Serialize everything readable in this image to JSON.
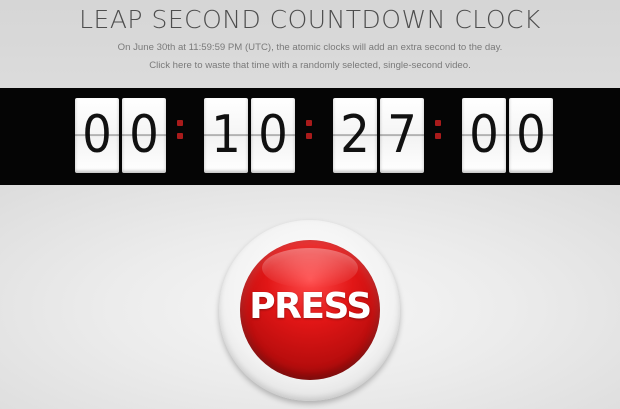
{
  "header": {
    "title": "LEAP SECOND COUNTDOWN CLOCK",
    "line1": "On June 30th at 11:59:59 PM (UTC), the atomic clocks will add an extra second to the day.",
    "line2": "Click here to waste that time with a randomly selected, single-second video."
  },
  "countdown": {
    "digits": [
      "0",
      "0",
      "1",
      "0",
      "2",
      "7",
      "0",
      "0"
    ],
    "separator_color": "#a91b1b"
  },
  "button": {
    "label": "PRESS",
    "color": "#e11616"
  }
}
